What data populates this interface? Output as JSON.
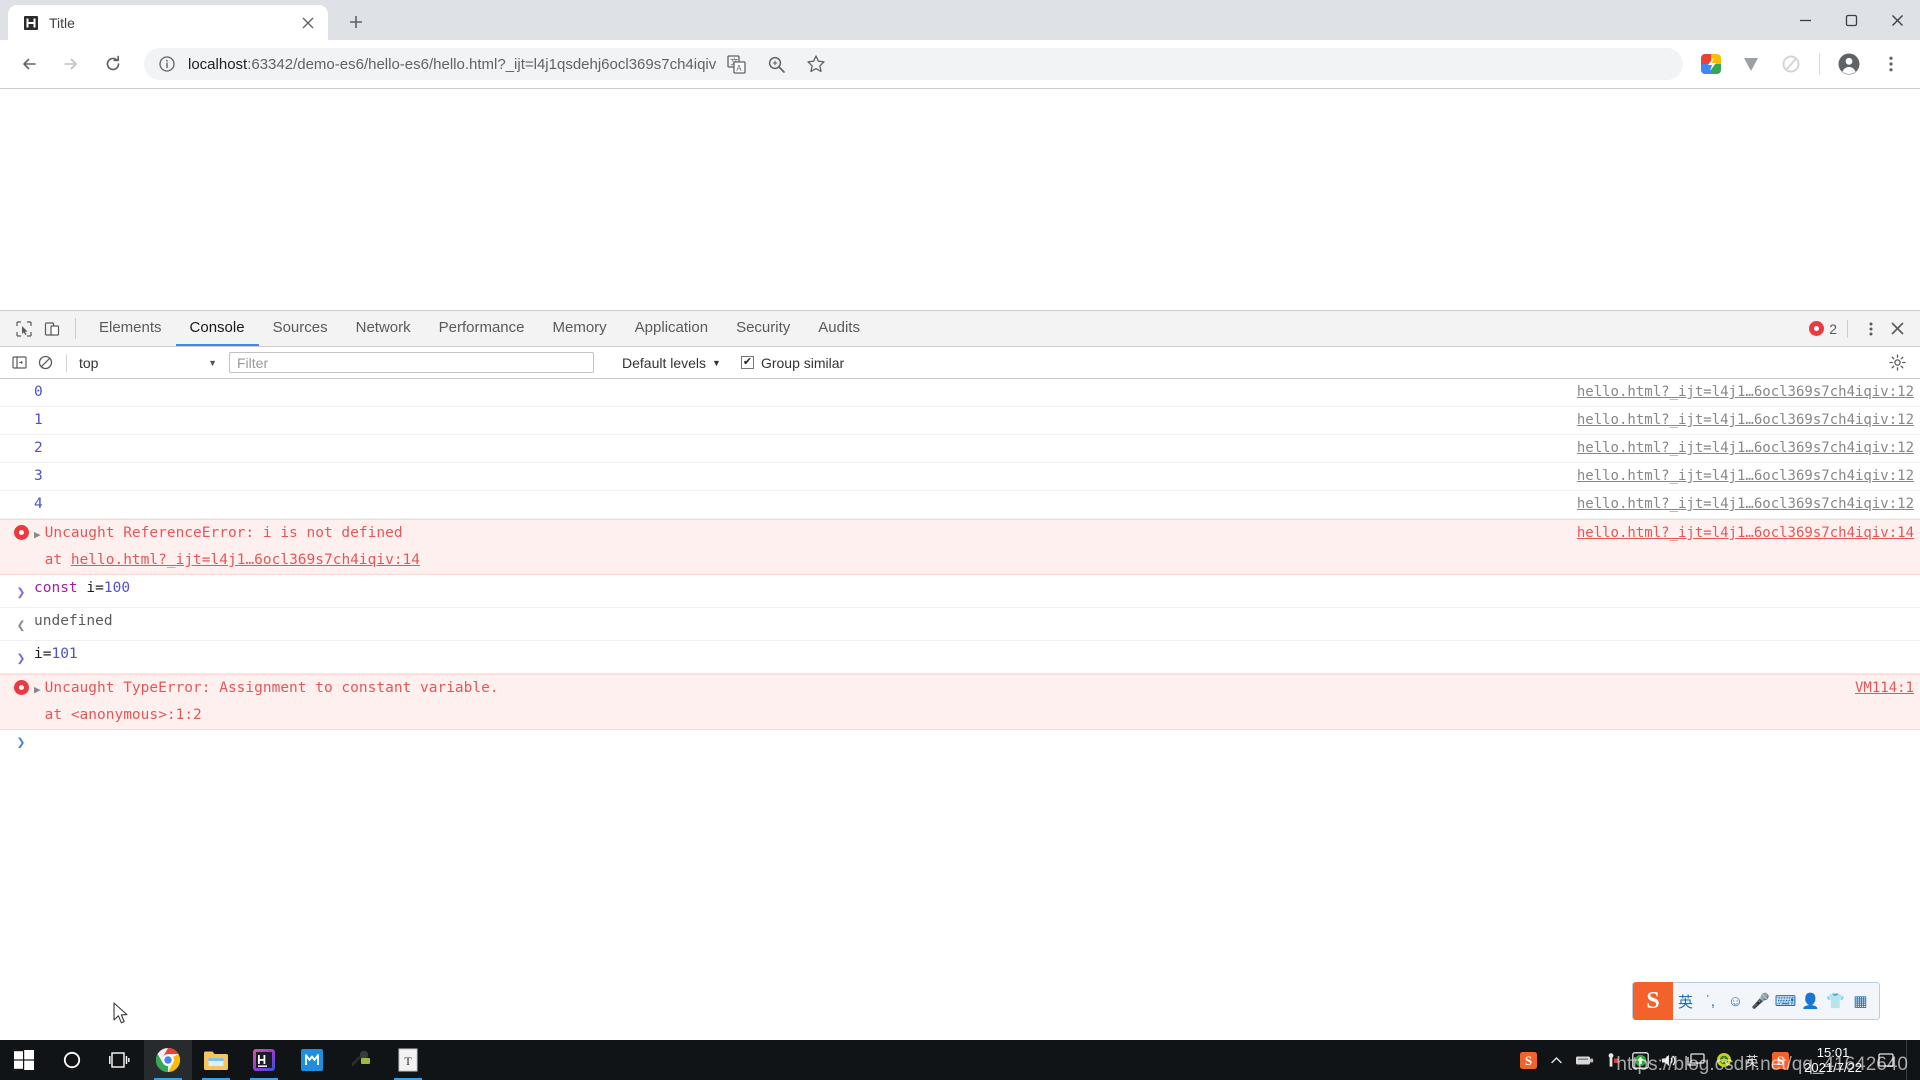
{
  "browser": {
    "tab": {
      "title": "Title",
      "favicon": "page-favicon",
      "close_label": "×"
    },
    "new_tab_label": "+",
    "window_controls": {
      "minimize": "—",
      "maximize": "❐",
      "close": "✕"
    },
    "nav": {
      "back": "←",
      "forward": "→",
      "reload": "⟳"
    },
    "omnibox": {
      "info_icon": "site-info-icon",
      "url": "localhost:63342/demo-es6/hello-es6/hello.html?_ijt=l4j1qsdehj6ocl369s7ch4iqiv",
      "host": "localhost",
      "rest": ":63342/demo-es6/hello-es6/hello.html?_ijt=l4j1qsdehj6ocl369s7ch4iqiv"
    },
    "actions": [
      {
        "name": "translate-icon",
        "label": "translate"
      },
      {
        "name": "zoom-icon",
        "label": "zoom"
      },
      {
        "name": "bookmark-star-icon",
        "label": "bookmark"
      },
      {
        "name": "extension-colorful-icon",
        "label": "extension"
      },
      {
        "name": "extension-v-icon",
        "label": "extension"
      },
      {
        "name": "extension-circle-icon",
        "label": "extension"
      },
      {
        "name": "profile-avatar",
        "label": "profile"
      },
      {
        "name": "chrome-menu-icon",
        "label": "menu"
      }
    ]
  },
  "devtools": {
    "tabs": [
      {
        "label": "Elements",
        "active": false
      },
      {
        "label": "Console",
        "active": true
      },
      {
        "label": "Sources",
        "active": false
      },
      {
        "label": "Network",
        "active": false
      },
      {
        "label": "Performance",
        "active": false
      },
      {
        "label": "Memory",
        "active": false
      },
      {
        "label": "Application",
        "active": false
      },
      {
        "label": "Security",
        "active": false
      },
      {
        "label": "Audits",
        "active": false
      }
    ],
    "inspect_icon": "inspect-element-icon",
    "device_icon": "toggle-device-toolbar-icon",
    "error_count": "2",
    "kebab_label": "⋮",
    "close_label": "✕",
    "filterbar": {
      "sidebar_icon": "console-sidebar-icon",
      "clear_icon": "clear-console-icon",
      "context": "top",
      "context_caret": "▼",
      "filter_placeholder": "Filter",
      "filter_value": "",
      "levels_label": "Default levels",
      "levels_caret": "▼",
      "group_similar_label": "Group similar",
      "group_similar_checked": true,
      "settings_icon": "console-settings-gear-icon"
    }
  },
  "console": {
    "source_link_base": "hello.html?_ijt=l4j1…6ocl369s7ch4iqiv",
    "rows": [
      {
        "kind": "log",
        "text": "0",
        "source": "hello.html?_ijt=l4j1…6ocl369s7ch4iqiv:12"
      },
      {
        "kind": "log",
        "text": "1",
        "source": "hello.html?_ijt=l4j1…6ocl369s7ch4iqiv:12"
      },
      {
        "kind": "log",
        "text": "2",
        "source": "hello.html?_ijt=l4j1…6ocl369s7ch4iqiv:12"
      },
      {
        "kind": "log",
        "text": "3",
        "source": "hello.html?_ijt=l4j1…6ocl369s7ch4iqiv:12"
      },
      {
        "kind": "log",
        "text": "4",
        "source": "hello.html?_ijt=l4j1…6ocl369s7ch4iqiv:12"
      },
      {
        "kind": "error",
        "text": "Uncaught ReferenceError: i is not defined",
        "stack_prefix": "    at ",
        "stack_link": "hello.html?_ijt=l4j1…6ocl369s7ch4iqiv:14",
        "source": "hello.html?_ijt=l4j1…6ocl369s7ch4iqiv:14"
      },
      {
        "kind": "input",
        "keyword": "const ",
        "ident": "i=",
        "number": "100"
      },
      {
        "kind": "output",
        "text": "undefined"
      },
      {
        "kind": "input2",
        "ident": "i=",
        "number": "101"
      },
      {
        "kind": "error",
        "text": "Uncaught TypeError: Assignment to constant variable.",
        "stack_prefix": "    at ",
        "stack_link": "<anonymous>:1:2",
        "source": "VM114:1"
      }
    ],
    "prompt_caret": "❯"
  },
  "ime": {
    "logo": "S",
    "items": [
      {
        "name": "ime-mode-english",
        "glyph": "英"
      },
      {
        "name": "ime-punctuation-icon",
        "glyph": "˙,"
      },
      {
        "name": "ime-emoji-icon",
        "glyph": "☺"
      },
      {
        "name": "ime-voice-icon",
        "glyph": "🎤"
      },
      {
        "name": "ime-keyboard-icon",
        "glyph": "⌨"
      },
      {
        "name": "ime-user-icon",
        "glyph": "👤"
      },
      {
        "name": "ime-skin-icon",
        "glyph": "👕"
      },
      {
        "name": "ime-toolbox-icon",
        "glyph": "▦"
      }
    ]
  },
  "taskbar": {
    "items": [
      {
        "name": "start-button",
        "glyph": "⊞",
        "state": ""
      },
      {
        "name": "cortana-search-button",
        "glyph": "○",
        "state": ""
      },
      {
        "name": "task-view-button",
        "glyph": "☰",
        "state": ""
      },
      {
        "name": "taskbar-chrome",
        "glyph": "C",
        "state": "active running"
      },
      {
        "name": "taskbar-file-explorer",
        "glyph": "F",
        "state": "running"
      },
      {
        "name": "taskbar-webstorm",
        "glyph": "W",
        "state": "running"
      },
      {
        "name": "taskbar-maxthon",
        "glyph": "M",
        "state": ""
      },
      {
        "name": "taskbar-tools",
        "glyph": "T",
        "state": ""
      },
      {
        "name": "taskbar-texteditor",
        "glyph": "T",
        "state": "running"
      }
    ],
    "tray": [
      {
        "name": "tray-sogou-icon",
        "glyph": "S"
      },
      {
        "name": "tray-show-hidden-icons",
        "glyph": "∧"
      },
      {
        "name": "tray-driver-icon",
        "glyph": "⌨"
      },
      {
        "name": "tray-security-icon",
        "glyph": "☣"
      },
      {
        "name": "tray-update-icon",
        "glyph": "⬆"
      },
      {
        "name": "tray-volume-icon",
        "glyph": "🔊"
      },
      {
        "name": "tray-network-icon",
        "glyph": "🖥"
      },
      {
        "name": "tray-shield-icon",
        "glyph": "⬤"
      },
      {
        "name": "tray-ime-icon",
        "glyph": "英"
      },
      {
        "name": "tray-sogou-2-icon",
        "glyph": "S"
      }
    ],
    "clock": {
      "time": "15:01",
      "date": "2021/7/22"
    }
  },
  "watermark": "https://blog.csdn.net/qq_41642640",
  "colors": {
    "accent": "#4285f4",
    "error": "#eb3941",
    "error_text": "#e45757",
    "error_bg": "#fff0f0",
    "number": "#5050c8",
    "keyword": "#a020a0",
    "tab_strip": "#dee1e6",
    "omnibox_bg": "#f1f3f4",
    "taskbar": "#101417"
  }
}
